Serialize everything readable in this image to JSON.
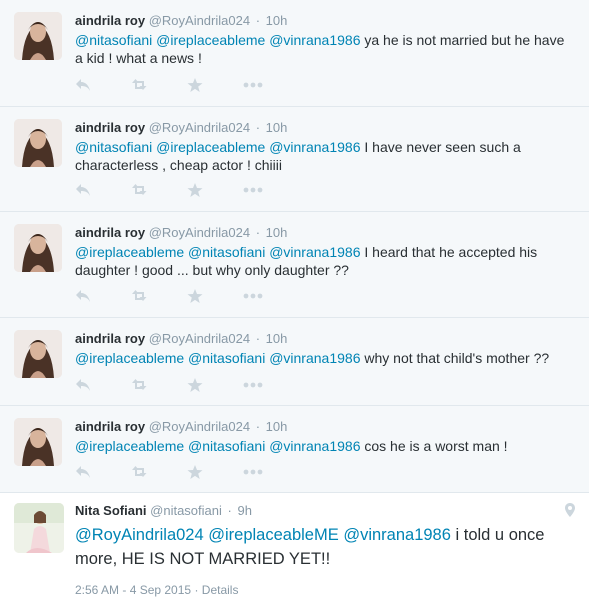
{
  "tweets": [
    {
      "name": "aindrila roy",
      "handle": "@RoyAindrila024",
      "sep": "·",
      "time": "10h",
      "mentions": [
        "@nitasofiani",
        "@ireplaceableme",
        "@vinrana1986"
      ],
      "body": " ya he is not married but he have a kid ! what a news !"
    },
    {
      "name": "aindrila roy",
      "handle": "@RoyAindrila024",
      "sep": "·",
      "time": "10h",
      "mentions": [
        "@nitasofiani",
        "@ireplaceableme",
        "@vinrana1986"
      ],
      "body": " I have never seen such a characterless , cheap actor ! chiiii"
    },
    {
      "name": "aindrila roy",
      "handle": "@RoyAindrila024",
      "sep": "·",
      "time": "10h",
      "mentions": [
        "@ireplaceableme",
        "@nitasofiani",
        "@vinrana1986"
      ],
      "body": " I heard that he accepted his daughter ! good ... but why only daughter ??"
    },
    {
      "name": "aindrila roy",
      "handle": "@RoyAindrila024",
      "sep": "·",
      "time": "10h",
      "mentions": [
        "@ireplaceableme",
        "@nitasofiani",
        "@vinrana1986"
      ],
      "body": " why not that child's mother ??"
    },
    {
      "name": "aindrila roy",
      "handle": "@RoyAindrila024",
      "sep": "·",
      "time": "10h",
      "mentions": [
        "@ireplaceableme",
        "@nitasofiani",
        "@vinrana1986"
      ],
      "body": " cos he is a worst man !"
    }
  ],
  "main_tweet": {
    "name": "Nita Sofiani",
    "handle": "@nitasofiani",
    "sep": "·",
    "time": "9h",
    "mentions": [
      "@RoyAindrila024",
      "@ireplaceableME",
      "@vinrana1986"
    ],
    "body": " i told u once more, HE IS NOT MARRIED YET!!",
    "timestamp": "2:56 AM - 4 Sep 2015",
    "meta_sep": "·",
    "details": "Details",
    "location_icon": "map-pin-icon"
  },
  "icons": [
    "reply-icon",
    "retweet-icon",
    "favorite-icon",
    "more-icon"
  ],
  "colors": {
    "link": "#0084b4",
    "muted": "#8899a6",
    "action_icon": "#ccd6dd",
    "reply_bg": "#f5f8fa",
    "divider": "#e1e8ed"
  }
}
